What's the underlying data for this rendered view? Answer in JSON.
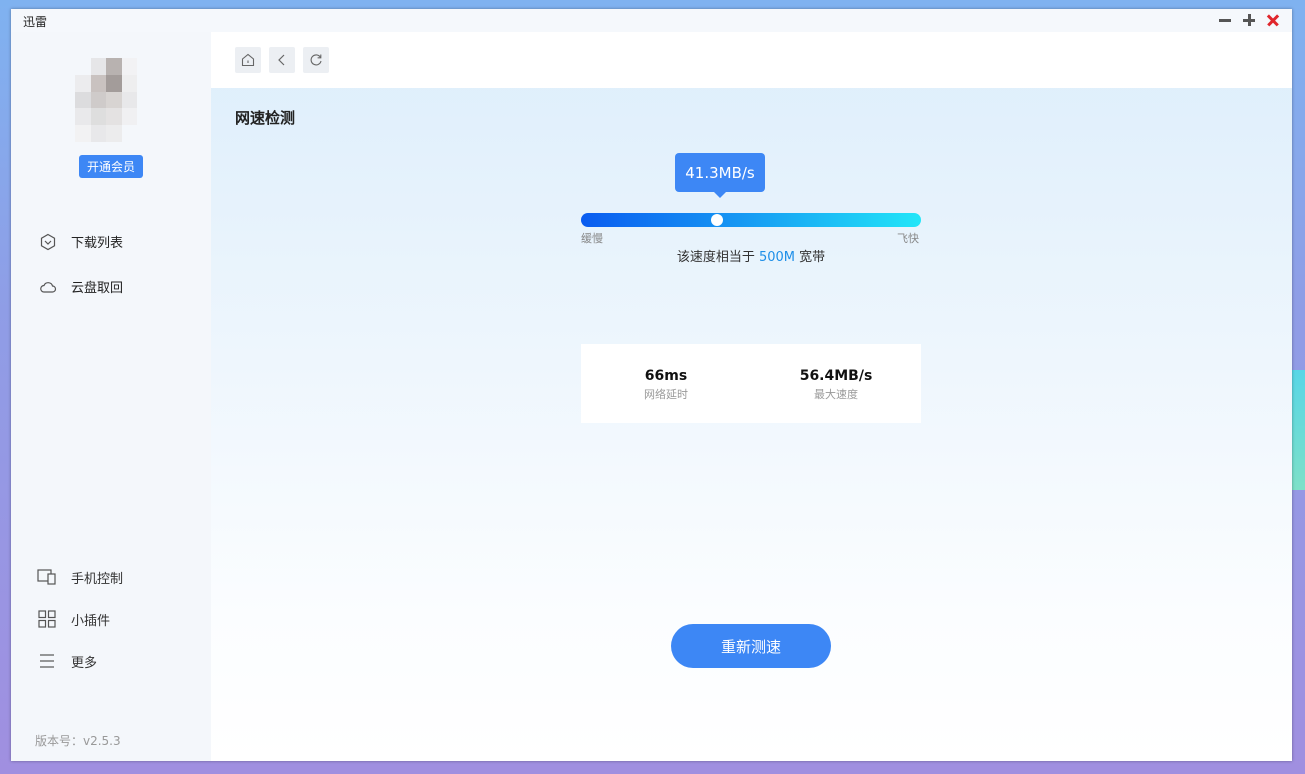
{
  "app": {
    "title": "迅雷",
    "controls": [
      "minimize",
      "maximize",
      "close"
    ]
  },
  "sidebar": {
    "vip_label": "开通会员",
    "nav": [
      {
        "label": "下载列表",
        "icon": "download-list-icon"
      },
      {
        "label": "云盘取回",
        "icon": "cloud-icon"
      }
    ],
    "bottom": [
      {
        "label": "手机控制",
        "icon": "phone-control-icon"
      },
      {
        "label": "小插件",
        "icon": "plugin-grid-icon"
      },
      {
        "label": "更多",
        "icon": "menu-icon"
      }
    ],
    "version": "版本号：v2.5.3"
  },
  "toolbar": {
    "buttons": [
      "home-icon",
      "back-icon",
      "refresh-icon"
    ]
  },
  "speedtest": {
    "title": "网速检测",
    "current_speed": "41.3MB/s",
    "position_fraction": 0.4,
    "slow_label": "缓慢",
    "fast_label": "飞快",
    "equiv_prefix": "该速度相当于",
    "equiv_value": "500M",
    "equiv_suffix": "宽带",
    "latency_value": "66ms",
    "latency_label": "网络延时",
    "max_speed_value": "56.4MB/s",
    "max_speed_label": "最大速度",
    "retest_label": "重新测速"
  },
  "colors": {
    "accent": "#3d87f5",
    "highlight": "#1e8fe8",
    "close": "#e0262c"
  }
}
